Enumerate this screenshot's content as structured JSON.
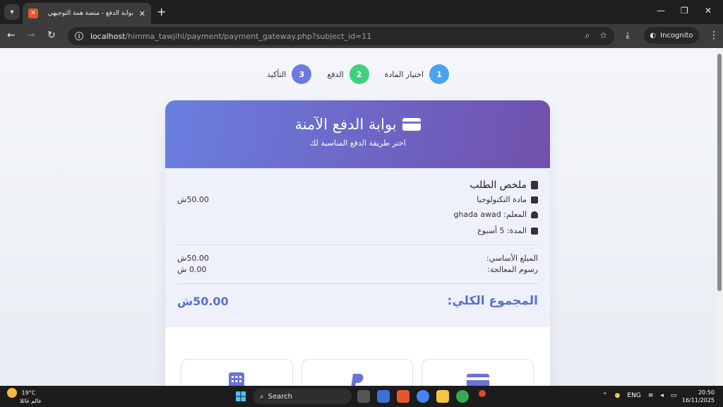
{
  "browser": {
    "tab_title": "بوابة الدفع - منصة همة التوجيهي",
    "tab_close": "✕",
    "new_tab": "+",
    "url_host": "localhost",
    "url_path": "/himma_tawjihi/payment/payment_gateway.php?subject_id=11",
    "incognito_label": "Incognito",
    "window_min": "—",
    "window_restore": "❐",
    "window_close": "✕"
  },
  "steps": [
    {
      "number": "1",
      "label": "اختيار المادة",
      "color": "#4aa3f0"
    },
    {
      "number": "2",
      "label": "الدفع",
      "color": "#3fd17a"
    },
    {
      "number": "3",
      "label": "التأكيد",
      "color": "#6b7be0"
    }
  ],
  "card": {
    "title": "بوابة الدفع الآمنة",
    "subtitle": "اختر طريقة الدفع المناسبة لك"
  },
  "summary": {
    "title": "ملخص الطلب",
    "subject": "مادة التكنولوجيا",
    "subject_price": "50.00ش",
    "teacher": "المعلم: ghada awad",
    "duration": "المدة: 5 أسبوع",
    "base_label": "المبلغ الأساسي:",
    "base_value": "50.00ش",
    "fee_label": "رسوم المعالجة:",
    "fee_value": "0.00 ش",
    "total_label": "المجموع الكلي:",
    "total_value": "50.00ش"
  },
  "taskbar": {
    "temperature": "19°C",
    "weather_text": "غالم غائلا",
    "search_label": "Search",
    "lang": "ENG",
    "time": "20:50",
    "date": "16/11/2025"
  }
}
